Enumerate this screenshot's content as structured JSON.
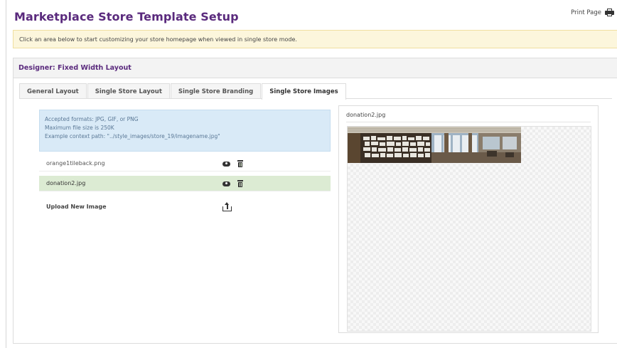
{
  "page": {
    "title": "Marketplace Store Template Setup",
    "print_label": "Print Page"
  },
  "notice": {
    "text": "Click an area below to start customizing your store homepage when viewed in single store mode."
  },
  "designer": {
    "header": "Designer: Fixed Width Layout",
    "tabs": [
      {
        "label": "General Layout",
        "active": false
      },
      {
        "label": "Single Store Layout",
        "active": false
      },
      {
        "label": "Single Store Branding",
        "active": false
      },
      {
        "label": "Single Store Images",
        "active": true
      }
    ]
  },
  "images_panel": {
    "info_lines": [
      "Accepted formats: JPG, GIF, or PNG",
      "Maximum file size is 250K",
      "Example context path: \"../style_images/store_19/imagename.jpg\""
    ],
    "files": [
      {
        "name": "orange1tileback.png",
        "selected": false
      },
      {
        "name": "donation2.jpg",
        "selected": true
      }
    ],
    "upload_label": "Upload New Image"
  },
  "preview": {
    "title": "donation2.jpg"
  }
}
